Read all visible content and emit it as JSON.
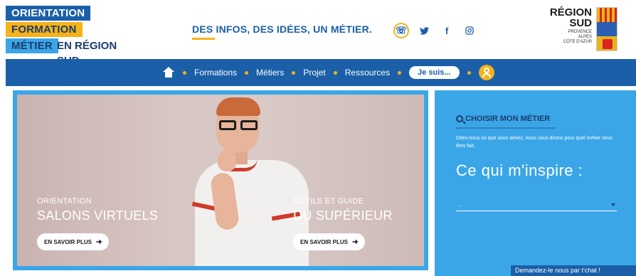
{
  "logo": {
    "line1": "ORIENTATION",
    "line2": "FORMATION",
    "line3": "MÉTIER",
    "line3_suffix": "EN RÉGION SUD."
  },
  "tagline": "DES INFOS, DES IDÉES, UN MÉTIER.",
  "socials": [
    {
      "icon": "phone-icon",
      "glyph": "☏"
    },
    {
      "icon": "twitter-icon",
      "glyph": "🐦"
    },
    {
      "icon": "facebook-icon",
      "glyph": "f"
    },
    {
      "icon": "instagram-icon",
      "glyph": "◎"
    }
  ],
  "region": {
    "name1": "RÉGION",
    "name2": "SUD",
    "sub1": "PROVENCE",
    "sub2": "ALPES",
    "sub3": "CÔTE D'AZUR"
  },
  "nav": {
    "items": [
      "Formations",
      "Métiers",
      "Projet",
      "Ressources"
    ],
    "je_suis": "Je suis..."
  },
  "hero": {
    "left": {
      "kicker": "ORIENTATION",
      "title": "SALONS VIRTUELS",
      "cta": "EN SAVOIR PLUS"
    },
    "right": {
      "kicker": "OUTILS ET GUIDE",
      "title": "DU SUPÉRIEUR",
      "cta": "EN SAVOIR PLUS"
    }
  },
  "side": {
    "label": "CHOISIR MON MÉTIER",
    "desc": "Dites-nous ce que vous aimez, nous vous dirons pour quel métier vous êtes fait.",
    "big": "Ce qui m'inspire :",
    "select_value": "..."
  },
  "chat": "Demandez-le nous par t'chat !",
  "colors": {
    "primary_blue": "#1a5fa8",
    "light_blue": "#3aa6e8",
    "accent_yellow": "#f5b21a"
  }
}
